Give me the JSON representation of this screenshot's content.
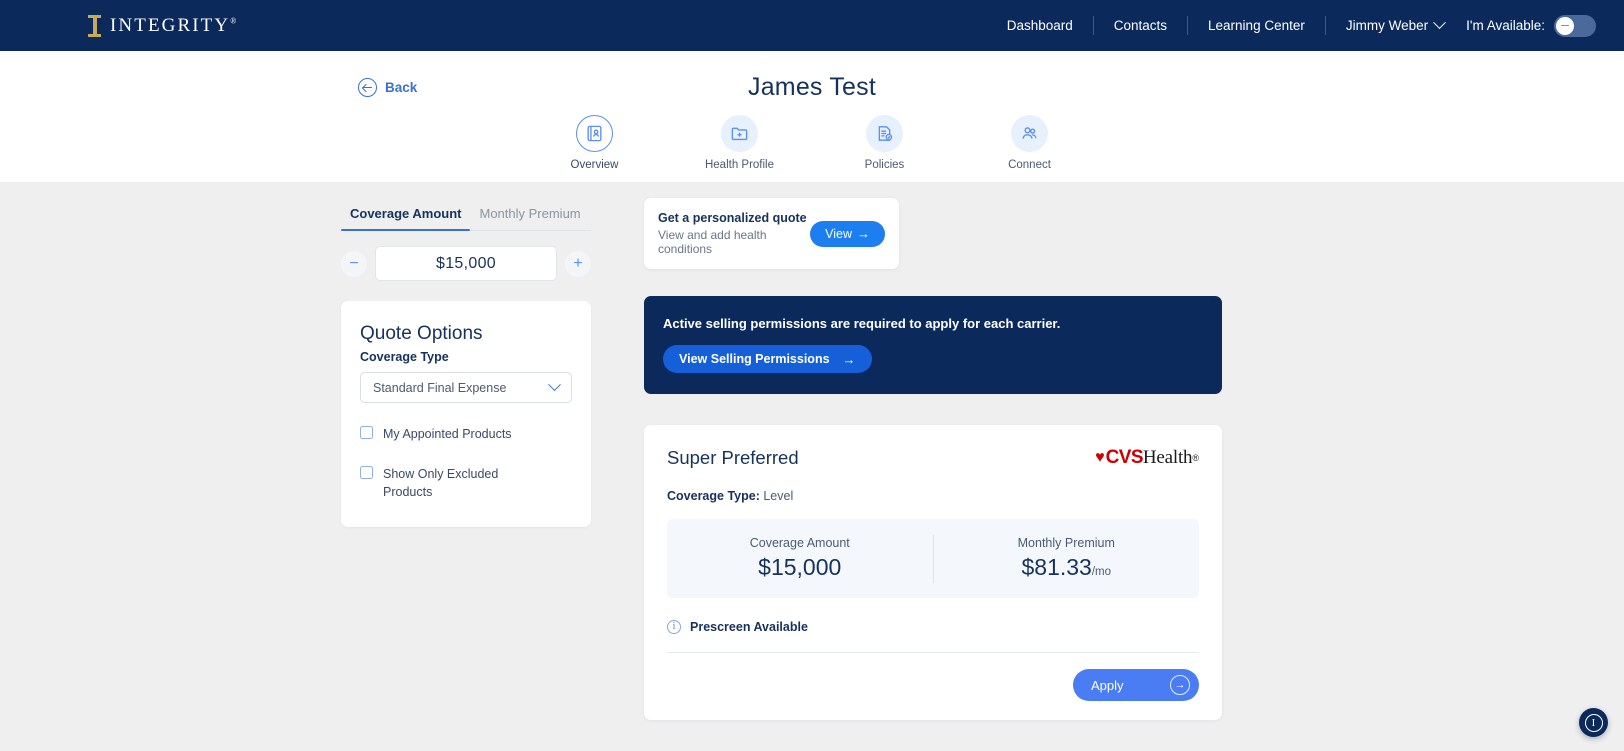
{
  "topnav": {
    "brand": "INTEGRITY",
    "brand_reg": "®",
    "links": [
      {
        "label": "Dashboard"
      },
      {
        "label": "Contacts"
      },
      {
        "label": "Learning Center"
      }
    ],
    "user": "Jimmy Weber",
    "availability_label": "I'm Available:",
    "availability_on": false,
    "bg_color": "#0b2a5b",
    "accent_gold": "#c8a85c"
  },
  "profile": {
    "back_label": "Back",
    "client_name": "James Test",
    "tabs": [
      {
        "label": "Overview",
        "icon": "id-card-icon",
        "active": true
      },
      {
        "label": "Health Profile",
        "icon": "folder-plus-icon",
        "active": false
      },
      {
        "label": "Policies",
        "icon": "policy-document-icon",
        "active": false
      },
      {
        "label": "Connect",
        "icon": "people-icon",
        "active": false
      }
    ]
  },
  "left_panel": {
    "mode_tabs": [
      {
        "label": "Coverage Amount",
        "active": true
      },
      {
        "label": "Monthly Premium",
        "active": false
      }
    ],
    "stepper": {
      "decrement": "−",
      "increment": "+",
      "value": "$15,000"
    },
    "quote_options": {
      "title": "Quote Options",
      "coverage_type_label": "Coverage Type",
      "coverage_type_value": "Standard Final Expense",
      "coverage_type_options": [
        "Standard Final Expense"
      ],
      "checkboxes": [
        {
          "label": "My Appointed Products",
          "checked": false
        },
        {
          "label": "Show Only Excluded Products",
          "checked": false
        }
      ]
    }
  },
  "promo": {
    "title": "Get a personalized quote",
    "subtitle": "View and add health conditions",
    "button_label": "View",
    "button_arrow": "→",
    "button_color": "#1d7ef0"
  },
  "permissions_banner": {
    "message": "Active selling permissions are required to apply for each carrier.",
    "button_label": "View Selling Permissions",
    "button_arrow": "→",
    "bg_color": "#0b2a5b",
    "button_color": "#1560d8"
  },
  "product_card": {
    "title": "Super Preferred",
    "carrier": {
      "heart": "♥",
      "mark": "CVS",
      "name": "Health",
      "registered": "®",
      "red": "#cc0000"
    },
    "coverage_type_label": "Coverage Type:",
    "coverage_type_value": "Level",
    "figures": [
      {
        "label": "Coverage Amount",
        "value": "$15,000",
        "suffix": ""
      },
      {
        "label": "Monthly Premium",
        "value": "$81.33",
        "suffix": "/mo"
      }
    ],
    "prescreen_label": "Prescreen Available",
    "prescreen_icon": "info-icon",
    "apply_label": "Apply",
    "apply_arrow": "→",
    "apply_color": "#4a7cf3"
  },
  "fab": {
    "label": "I",
    "icon": "integrity-help-icon"
  }
}
